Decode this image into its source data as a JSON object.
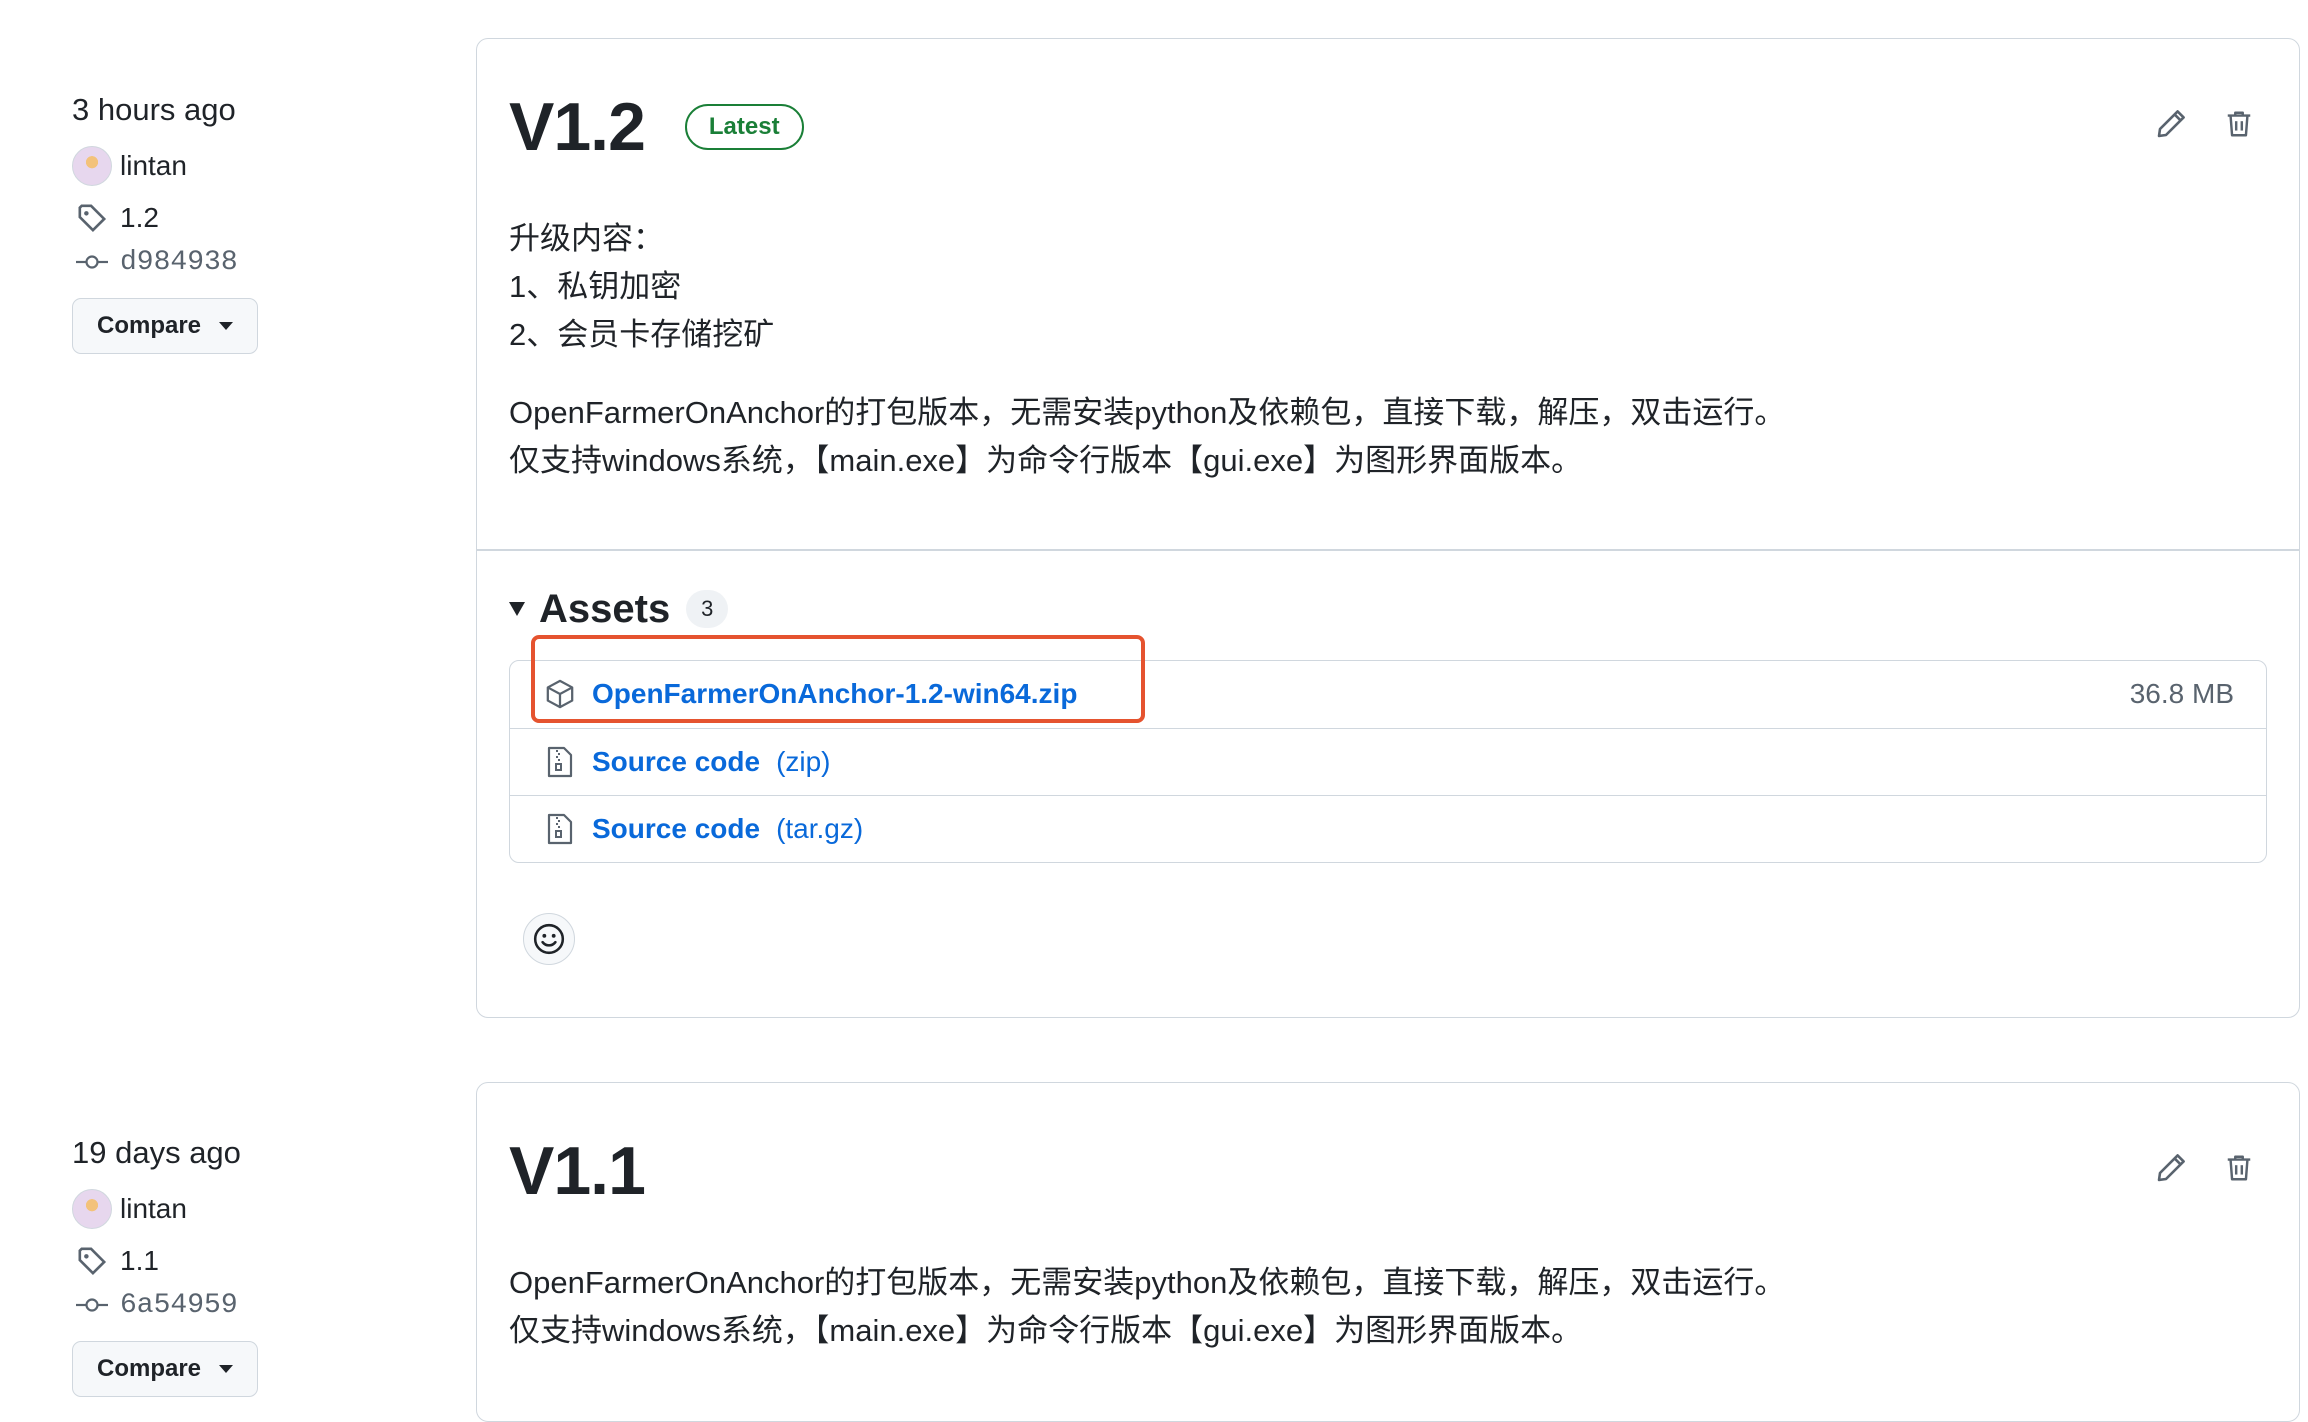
{
  "releases": [
    {
      "time": "3 hours ago",
      "author": "lintan",
      "tag": "1.2",
      "commit": "d984938",
      "compare_label": "Compare",
      "title": "V1.2",
      "badge": "Latest",
      "notes": [
        "升级内容：",
        "1、私钥加密",
        "2、会员卡存储挖矿"
      ],
      "description": [
        "OpenFarmerOnAnchor的打包版本，无需安装python及依赖包，直接下载，解压，双击运行。",
        "仅支持windows系统，【main.exe】为命令行版本【gui.exe】为图形界面版本。"
      ],
      "assets_label": "Assets",
      "assets_count": "3",
      "assets": [
        {
          "name": "OpenFarmerOnAnchor-1.2-win64.zip",
          "size": "36.8 MB",
          "icon": "package-icon"
        },
        {
          "name": "Source code",
          "ext": "(zip)",
          "icon": "file-zip-icon"
        },
        {
          "name": "Source code",
          "ext": "(tar.gz)",
          "icon": "file-zip-icon"
        }
      ]
    },
    {
      "time": "19 days ago",
      "author": "lintan",
      "tag": "1.1",
      "commit": "6a54959",
      "compare_label": "Compare",
      "title": "V1.1",
      "description": [
        "OpenFarmerOnAnchor的打包版本，无需安装python及依赖包，直接下载，解压，双击运行。",
        "仅支持windows系统，【main.exe】为命令行版本【gui.exe】为图形界面版本。"
      ]
    }
  ],
  "colors": {
    "link": "#0969da",
    "latest": "#1a7f37",
    "highlight": "#e5532f",
    "border": "#d0d7de"
  }
}
